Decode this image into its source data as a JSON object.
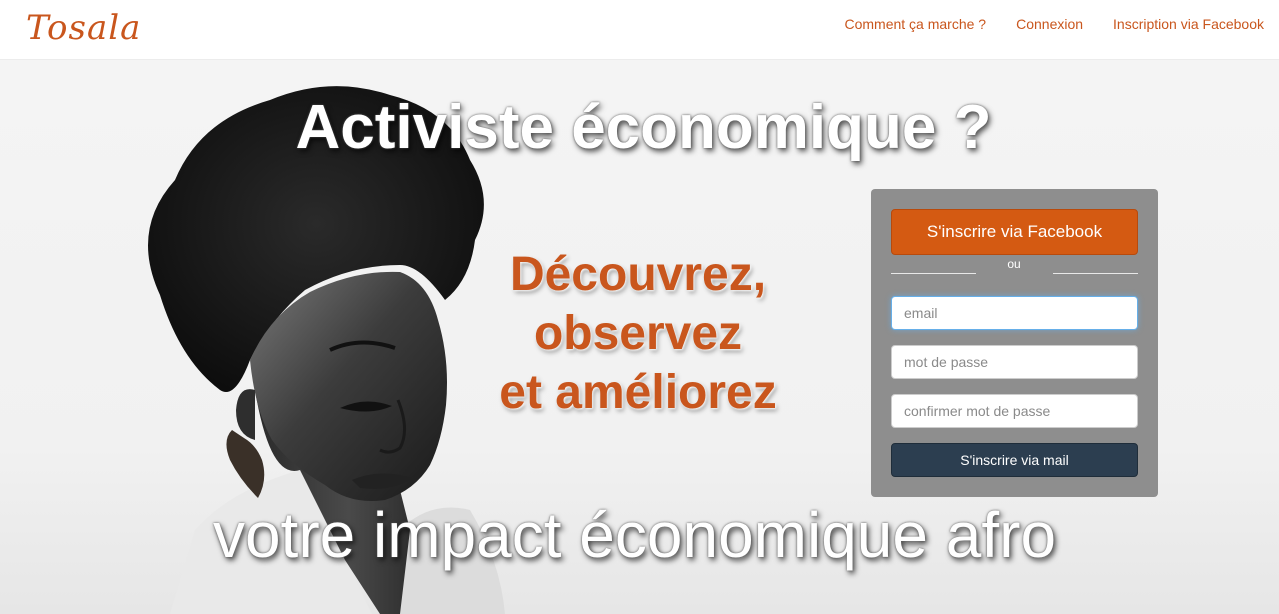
{
  "brand": {
    "logo_text": "Tosala",
    "accent_color": "#c9561d"
  },
  "nav": {
    "links": [
      {
        "label": "Comment ça marche ?"
      },
      {
        "label": "Connexion"
      },
      {
        "label": "Inscription via Facebook"
      }
    ]
  },
  "hero": {
    "headline_top": "Activiste économique ?",
    "tagline": [
      "Découvrez,",
      "observez",
      "et améliorez"
    ],
    "headline_bottom": "votre impact économique afro"
  },
  "signup": {
    "facebook_button": "S'inscrire via Facebook",
    "divider_text": "ou",
    "email_placeholder": "email",
    "password_placeholder": "mot de passe",
    "confirm_placeholder": "confirmer mot de passe",
    "mail_button": "S'inscrire via mail",
    "facebook_color": "#d45a12",
    "mail_button_color": "#2c3e50"
  }
}
